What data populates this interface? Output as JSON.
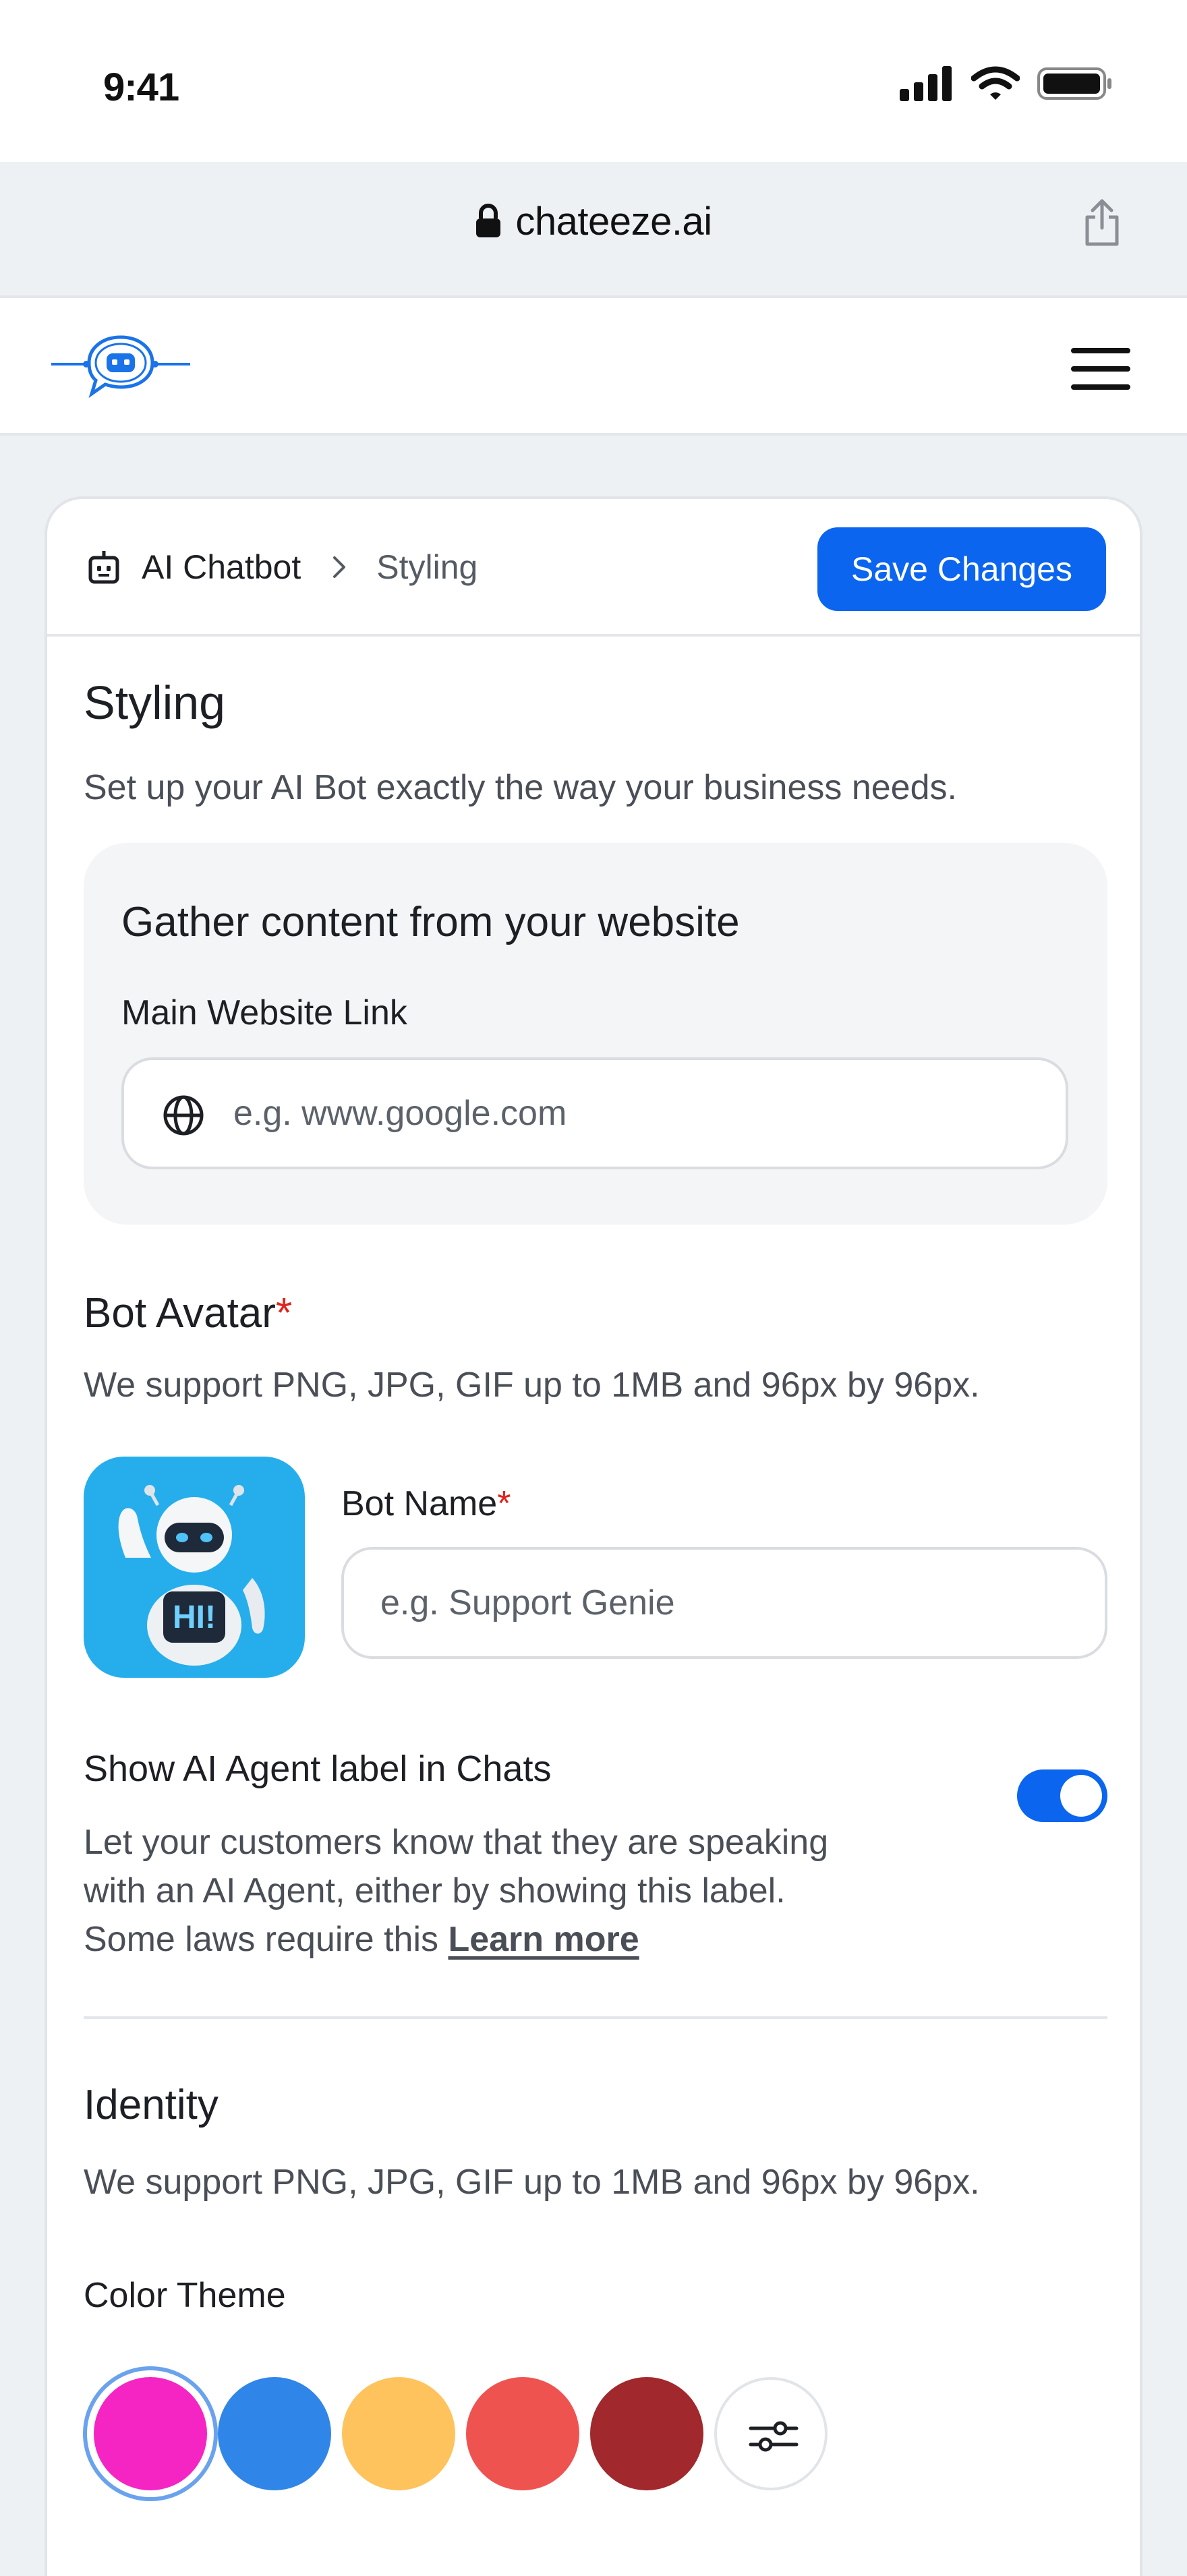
{
  "status_bar": {
    "time": "9:41"
  },
  "browser": {
    "url": "chateeze.ai"
  },
  "breadcrumb": {
    "root": "AI Chatbot",
    "current": "Styling"
  },
  "actions": {
    "save_label": "Save Changes"
  },
  "page": {
    "title": "Styling",
    "subtitle": "Set up your AI Bot exactly the way your business needs."
  },
  "gather": {
    "title": "Gather content from your website",
    "link_label": "Main Website Link",
    "link_placeholder": "e.g. www.google.com"
  },
  "avatar_section": {
    "title": "Bot Avatar",
    "required_mark": "*",
    "hint": "We support PNG, JPG, GIF up to 1MB and 96px by 96px.",
    "avatar_text": "HI!"
  },
  "bot_name": {
    "label": "Bot Name",
    "required_mark": "*",
    "placeholder": "e.g. Support Genie"
  },
  "agent_label": {
    "title": "Show AI Agent label in Chats",
    "desc_line1": "Let your customers know that they are speaking",
    "desc_line2": "with an AI Agent, either by showing this label.",
    "desc_line3": "Some laws require this",
    "learn_more": "Learn more",
    "enabled": true
  },
  "identity": {
    "title": "Identity",
    "hint": "We support PNG, JPG, GIF up to 1MB and 96px by 96px.",
    "color_label": "Color Theme",
    "colors": [
      "#f425c3",
      "#2f86e8",
      "#fec35c",
      "#ef5350",
      "#a1282c"
    ],
    "selected_color": "#f425c3",
    "custom_icon": "sliders-icon"
  },
  "colors": {
    "accent": "#0b65ef",
    "required": "#e0231d"
  }
}
